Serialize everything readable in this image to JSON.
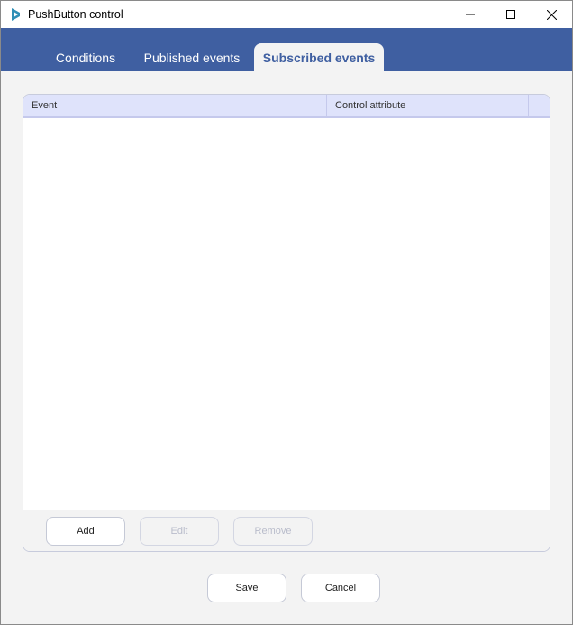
{
  "window": {
    "title": "PushButton control",
    "icons": {
      "app": "app-logo-icon",
      "minimize": "minimize-icon",
      "maximize": "maximize-icon",
      "close": "close-icon"
    }
  },
  "tabs": [
    {
      "label": "Conditions",
      "active": false
    },
    {
      "label": "Published events",
      "active": false
    },
    {
      "label": "Subscribed events",
      "active": true
    }
  ],
  "grid": {
    "columns": [
      "Event",
      "Control attribute",
      ""
    ],
    "rows": []
  },
  "grid_actions": {
    "add_label": "Add",
    "edit_label": "Edit",
    "edit_enabled": false,
    "remove_label": "Remove",
    "remove_enabled": false
  },
  "dialog_actions": {
    "save_label": "Save",
    "cancel_label": "Cancel"
  },
  "colors": {
    "tab_bar": "#3f5fa1",
    "header_bg": "#dfe3fb",
    "window_bg": "#f3f3f3"
  }
}
